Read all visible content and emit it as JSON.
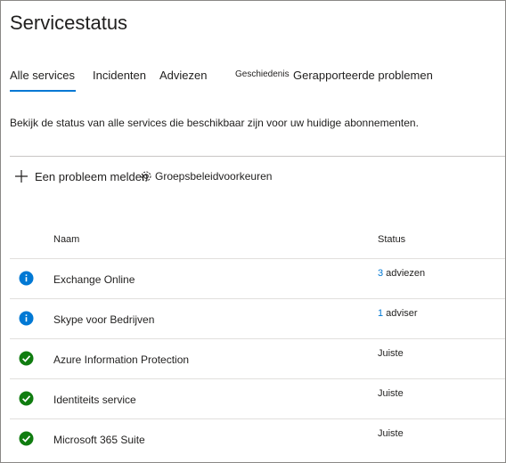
{
  "page": {
    "title": "Servicestatus",
    "description": "Bekijk de status van alle services die beschikbaar zijn voor uw huidige abonnementen."
  },
  "tabs": [
    {
      "label": "Alle services",
      "active": true
    },
    {
      "label": "Incidenten",
      "active": false
    },
    {
      "label": "Adviezen",
      "active": false
    },
    {
      "label": "Geschiedenis",
      "active": false
    },
    {
      "label": "Gerapporteerde problemen",
      "active": false
    }
  ],
  "toolbar": {
    "report_label": "Een probleem melden",
    "report_icon": "plus-icon",
    "preferences_label": "Groepsbeleidvoorkeuren",
    "preferences_icon": "gear-icon"
  },
  "table": {
    "columns": {
      "name": "Naam",
      "status": "Status"
    },
    "rows": [
      {
        "icon": "info-icon",
        "name": "Exchange Online",
        "status_count": "3",
        "status_text": "adviezen"
      },
      {
        "icon": "info-icon",
        "name": "Skype voor Bedrijven",
        "status_count": "1",
        "status_text": "adviser"
      },
      {
        "icon": "check-icon",
        "name": "Azure Information Protection",
        "status_count": "",
        "status_text": "Juiste"
      },
      {
        "icon": "check-icon",
        "name": "Identiteits service",
        "status_count": "",
        "status_text": "Juiste"
      },
      {
        "icon": "check-icon",
        "name": "Microsoft 365 Suite",
        "status_count": "",
        "status_text": "Juiste"
      }
    ]
  },
  "colors": {
    "accent": "#0078d4",
    "info": "#0078d4",
    "success": "#107c10"
  }
}
